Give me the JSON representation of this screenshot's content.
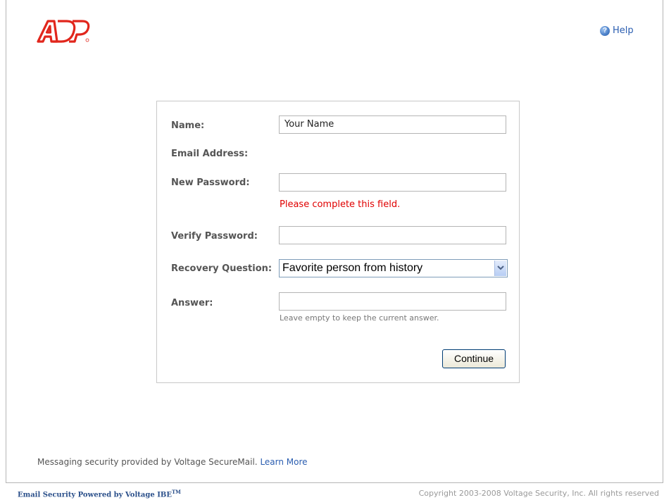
{
  "header": {
    "help_label": "Help",
    "brand_color": "#e1261c",
    "icons": {
      "logo": "adp-logo",
      "help": "help-icon"
    }
  },
  "form": {
    "name_label": "Name:",
    "name_value": "Your Name",
    "email_label": "Email Address:",
    "new_password_label": "New Password:",
    "new_password_value": "",
    "new_password_error": "Please complete this field.",
    "verify_password_label": "Verify Password:",
    "verify_password_value": "",
    "recovery_question_label": "Recovery Question:",
    "recovery_question_value": "Favorite person from history",
    "answer_label": "Answer:",
    "answer_value": "",
    "answer_hint": "Leave empty to keep the current answer.",
    "continue_label": "Continue",
    "error_color": "#e00000"
  },
  "footer": {
    "security_text": "Messaging security provided by Voltage SecureMail.",
    "learn_more_label": "Learn More",
    "powered_by_text": "Email Security Powered by Voltage IBE",
    "trademark": "TM",
    "copyright_text": "Copyright 2003-2008 Voltage Security, Inc. All rights reserved"
  }
}
